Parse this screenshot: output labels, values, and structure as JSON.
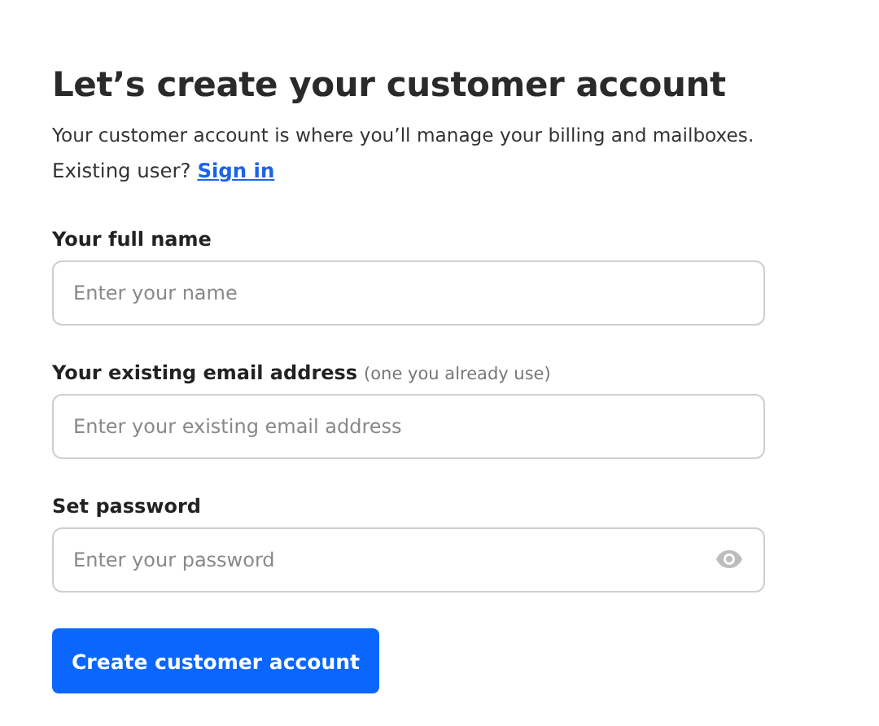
{
  "title": "Let’s create your customer account",
  "intro": "Your customer account is where you’ll manage your billing and mailboxes.",
  "existing_user": {
    "text": "Existing user?",
    "link": "Sign in"
  },
  "fields": [
    {
      "kind": "text",
      "label": "Your full name",
      "placeholder": "Enter your name"
    },
    {
      "kind": "email",
      "label": "Your existing email address",
      "hint": "(one you already use)",
      "placeholder": "Enter your existing email address"
    },
    {
      "kind": "password",
      "label": "Set password",
      "placeholder": "Enter your password"
    }
  ],
  "submit": "Create customer account"
}
